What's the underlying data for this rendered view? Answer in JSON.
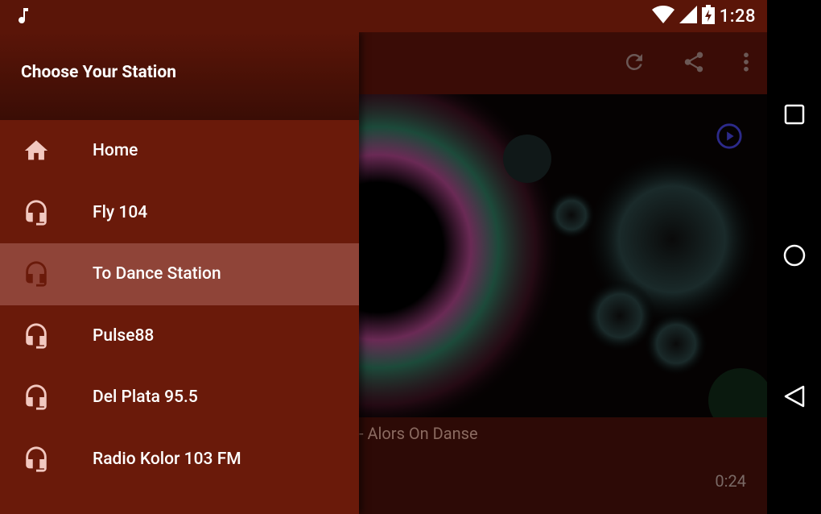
{
  "status_bar": {
    "time": "1:28"
  },
  "drawer": {
    "title": "Choose Your Station",
    "items": [
      {
        "label": "Home",
        "icon": "home-icon",
        "active": false
      },
      {
        "label": "Fly 104",
        "icon": "headphones-icon",
        "active": false
      },
      {
        "label": "To Dance Station",
        "icon": "headphones-icon",
        "active": true
      },
      {
        "label": "Pulse88",
        "icon": "headphones-icon",
        "active": false
      },
      {
        "label": "Del Plata 95.5",
        "icon": "headphones-icon",
        "active": false
      },
      {
        "label": "Radio Kolor 103 FM",
        "icon": "headphones-icon",
        "active": false
      }
    ]
  },
  "player": {
    "track_visible": "- Alors On Danse",
    "elapsed": "0:24"
  },
  "colors": {
    "drawer_bg": "#6a1a0a",
    "active_item": "#8f4438",
    "status_bar": "#5a1508",
    "icon": "#f2c8c0"
  }
}
